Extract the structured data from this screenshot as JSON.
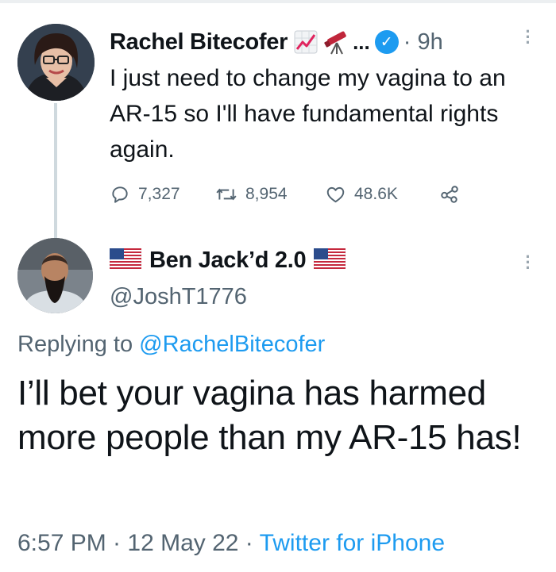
{
  "parent_tweet": {
    "author_name": "Rachel Bitecofer",
    "name_emojis": [
      "chart-increasing-icon",
      "telescope-icon"
    ],
    "ellipsis": "...",
    "time": "· 9h",
    "text": "I just need to change my vagina to an AR-15 so I'll have fundamental rights again.",
    "stats": {
      "replies": "7,327",
      "retweets": "8,954",
      "likes": "48.6K"
    }
  },
  "reply_tweet": {
    "author_name": "Ben Jack’d 2.0",
    "handle": "@JoshT1776",
    "replying_prefix": "Replying to",
    "replying_to": "@RachelBitecofer",
    "text": "I’ll bet your vagina has harmed more people than my AR-15 has!",
    "timestamp": "6:57 PM · 12 May 22 ·",
    "source": "Twitter for iPhone"
  },
  "colors": {
    "verified": "#1d9bf0",
    "link": "#1d9bf0",
    "muted": "#536471",
    "text": "#0f1419"
  }
}
